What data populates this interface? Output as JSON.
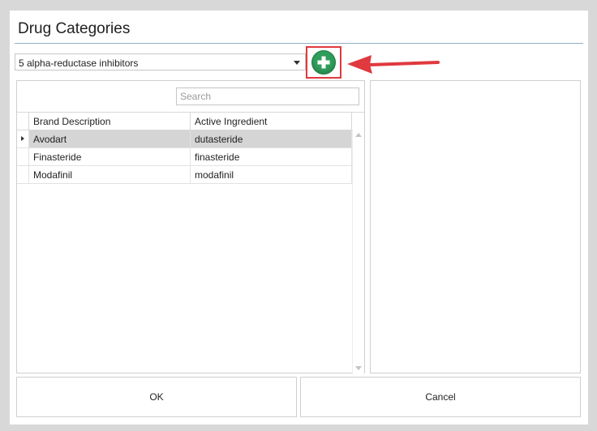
{
  "dialog": {
    "title": "Drug Categories"
  },
  "category": {
    "selected": "5 alpha-reductase inhibitors"
  },
  "add_button": {
    "icon": "plus-circle-icon",
    "color": "#2f9e5c"
  },
  "annotation": {
    "arrow_color": "#e0393e",
    "highlight_color": "#e0393e"
  },
  "search": {
    "placeholder": "Search",
    "value": ""
  },
  "grid": {
    "columns": [
      "Brand Description",
      "Active Ingredient"
    ],
    "rows": [
      {
        "brand": "Avodart",
        "ingredient": "dutasteride",
        "selected": true
      },
      {
        "brand": "Finasteride",
        "ingredient": "finasteride",
        "selected": false
      },
      {
        "brand": "Modafinil",
        "ingredient": "modafinil",
        "selected": false
      }
    ]
  },
  "buttons": {
    "ok": "OK",
    "cancel": "Cancel"
  }
}
